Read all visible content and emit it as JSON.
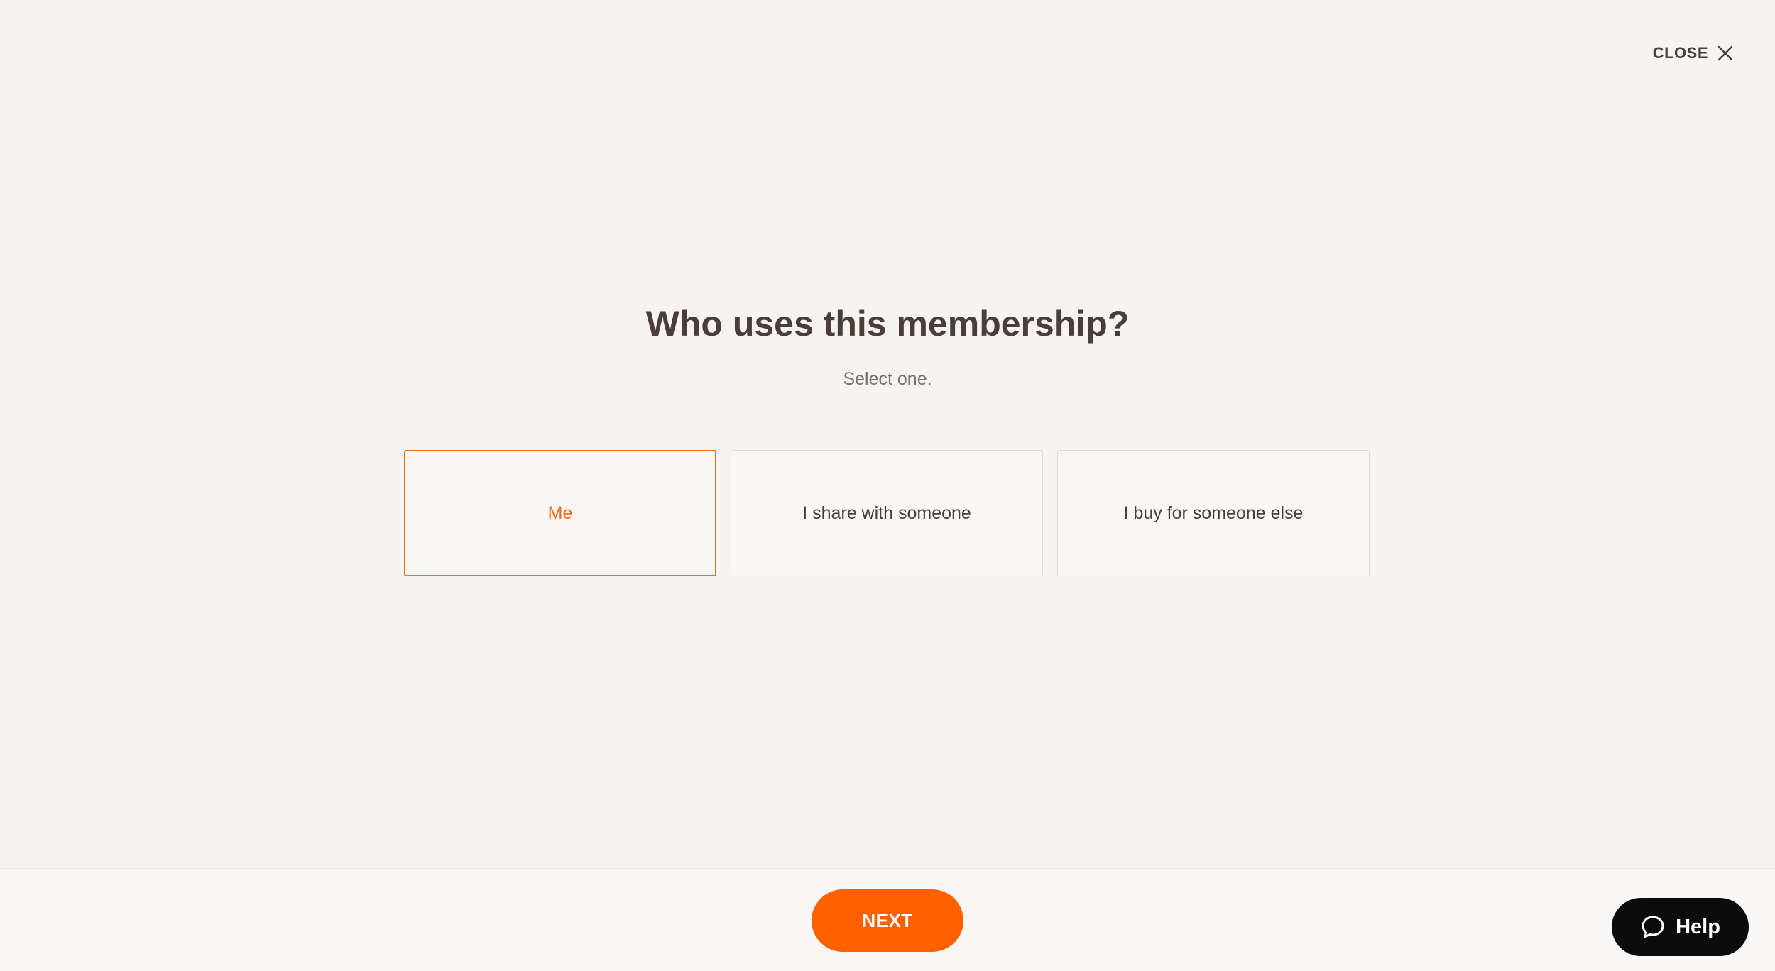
{
  "header": {
    "close_label": "CLOSE"
  },
  "question": {
    "title": "Who uses this membership?",
    "subtitle": "Select one."
  },
  "options": [
    {
      "label": "Me",
      "selected": true
    },
    {
      "label": "I share with someone",
      "selected": false
    },
    {
      "label": "I buy for someone else",
      "selected": false
    }
  ],
  "footer": {
    "next_label": "NEXT",
    "help_label": "Help"
  },
  "icons": {
    "close": "close-icon",
    "help": "chat-bubble-icon"
  },
  "colors": {
    "accent": "#ff6100",
    "selected_border": "#f06a18",
    "text": "#4b3e39",
    "background": "#f7f3f2",
    "help_bg": "#0b0b0b"
  }
}
